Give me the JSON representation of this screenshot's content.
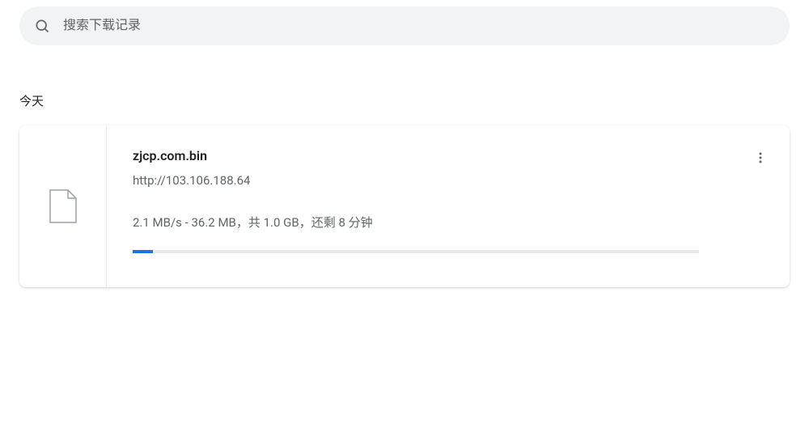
{
  "search": {
    "placeholder": "搜索下载记录"
  },
  "section": {
    "today_label": "今天"
  },
  "download": {
    "filename": "zjcp.com.bin",
    "url": "http://103.106.188.64",
    "status_text": "2.1 MB/s - 36.2 MB，共 1.0 GB，还剩 8 分钟",
    "progress_percent": 3.5
  }
}
